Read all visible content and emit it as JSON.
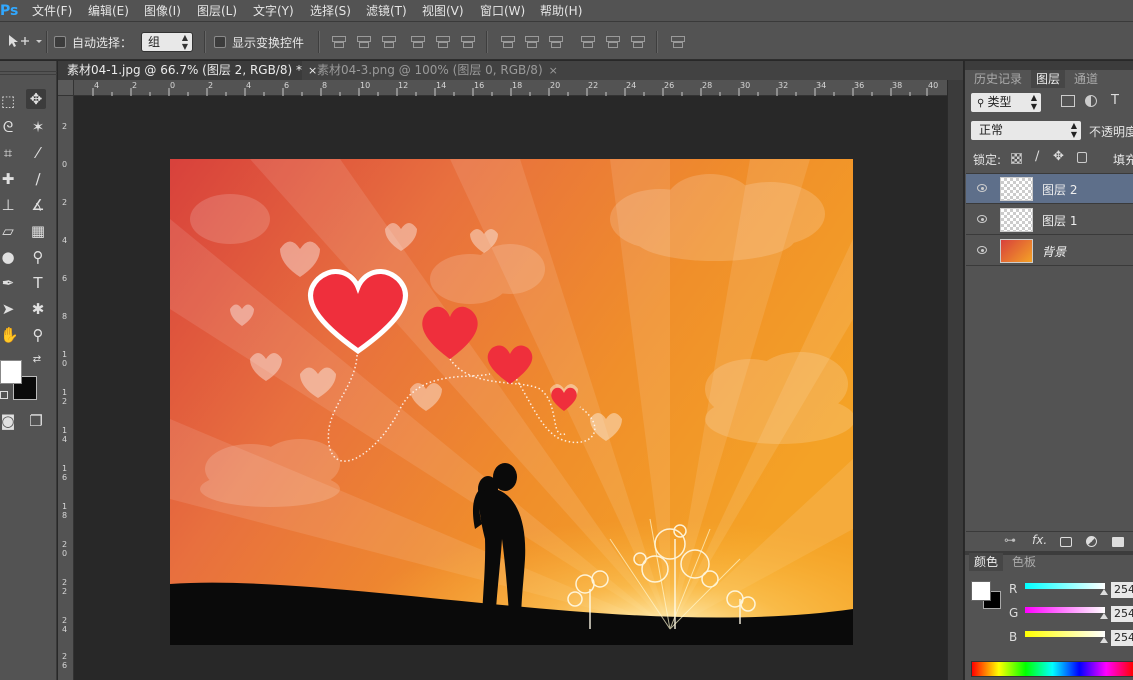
{
  "app_logo": "Ps",
  "menu": [
    "文件(F)",
    "编辑(E)",
    "图像(I)",
    "图层(L)",
    "文字(Y)",
    "选择(S)",
    "滤镜(T)",
    "视图(V)",
    "窗口(W)",
    "帮助(H)"
  ],
  "options": {
    "auto_select_label": "自动选择：",
    "auto_select_value": "组",
    "show_transform_label": "显示变换控件"
  },
  "tabs": [
    {
      "label": "素材04-1.jpg @ 66.7% (图层 2, RGB/8) *",
      "close": "×"
    },
    {
      "label": "素材04-3.png @ 100% (图层 0, RGB/8)",
      "close": "×"
    }
  ],
  "ruler_top": [
    "4",
    "2",
    "0",
    "2",
    "4",
    "6",
    "8",
    "10",
    "12",
    "14",
    "16",
    "18",
    "20",
    "22",
    "24",
    "26",
    "28",
    "30",
    "32",
    "34",
    "36",
    "38",
    "40"
  ],
  "ruler_left": [
    "2",
    "0",
    "2",
    "4",
    "6",
    "8",
    "10",
    "12",
    "14",
    "16",
    "18",
    "20",
    "22",
    "24",
    "26"
  ],
  "panels": {
    "tabs": [
      "历史记录",
      "图层",
      "通道"
    ],
    "filter_label": "类型",
    "filter_icons": [
      "image-filter-icon",
      "adjust-filter-icon",
      "text-filter-icon"
    ],
    "blend_mode": "正常",
    "opacity_label": "不透明度",
    "lock_label": "锁定:",
    "fill_label": "填充",
    "layers": [
      {
        "name": "图层 2",
        "selected": true
      },
      {
        "name": "图层 1",
        "selected": false
      },
      {
        "name": "背景",
        "selected": false
      }
    ],
    "bottom_icons": [
      "link-icon",
      "fx-icon",
      "mask-icon",
      "adjustment-icon",
      "folder-icon"
    ],
    "color_tabs": [
      "颜色",
      "色板"
    ],
    "rgb": [
      {
        "label": "R",
        "value": "254",
        "color": "#00ffff"
      },
      {
        "label": "G",
        "value": "254",
        "color": "#ff00ff"
      },
      {
        "label": "B",
        "value": "254",
        "color": "#ffff00"
      }
    ]
  }
}
